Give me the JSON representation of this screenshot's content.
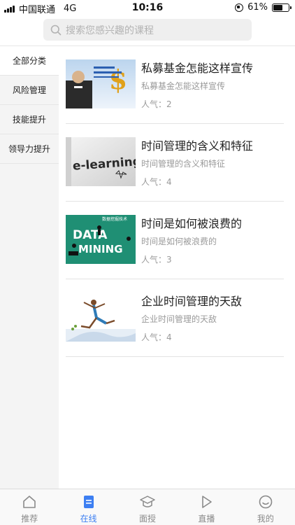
{
  "status_bar": {
    "carrier": "中国联通",
    "network": "4G",
    "time": "10:16",
    "battery_percent": "61%",
    "battery_level": 0.61
  },
  "search": {
    "placeholder": "搜索您感兴趣的课程",
    "icon": "search-icon"
  },
  "sidebar": {
    "items": [
      {
        "label": "全部分类",
        "active": true
      },
      {
        "label": "风险管理",
        "active": false
      },
      {
        "label": "技能提升",
        "active": false
      },
      {
        "label": "领导力提升",
        "active": false
      }
    ]
  },
  "courses": [
    {
      "title": "私募基金怎能这样宣传",
      "subtitle": "私募基金怎能这样宣传",
      "popularity": "人气：2",
      "thumb": "money-thumbnail"
    },
    {
      "title": "时间管理的含义和特征",
      "subtitle": "时间管理的含义和特征",
      "popularity": "人气：4",
      "thumb": "elearning-thumbnail"
    },
    {
      "title": "时间是如何被浪费的",
      "subtitle": "时间是如何被浪费的",
      "popularity": "人气：3",
      "thumb": "datamining-thumbnail"
    },
    {
      "title": "企业时间管理的天敌",
      "subtitle": "企业时间管理的天敌",
      "popularity": "人气：4",
      "thumb": "runner-thumbnail"
    }
  ],
  "thumb_text": {
    "elearning": "e-learning...",
    "data": "DATA",
    "mining": "MINING",
    "data_cn": "数据挖掘技术"
  },
  "tabbar": {
    "items": [
      {
        "label": "推荐",
        "icon": "home-icon",
        "active": false
      },
      {
        "label": "在线",
        "icon": "document-icon",
        "active": true
      },
      {
        "label": "面授",
        "icon": "graduation-cap-icon",
        "active": false
      },
      {
        "label": "直播",
        "icon": "play-icon",
        "active": false
      },
      {
        "label": "我的",
        "icon": "smiley-icon",
        "active": false
      }
    ]
  },
  "colors": {
    "accent": "#3d7ff2",
    "sidebar_bg": "#f4f4f4",
    "muted_text": "#9a9a9a"
  }
}
